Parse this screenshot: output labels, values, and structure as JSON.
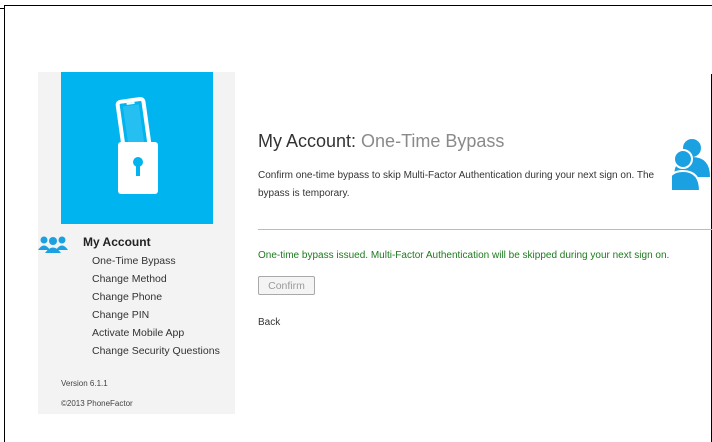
{
  "sidebar": {
    "account_title": "My Account",
    "items": [
      {
        "label": "One-Time Bypass"
      },
      {
        "label": "Change Method"
      },
      {
        "label": "Change Phone"
      },
      {
        "label": "Change PIN"
      },
      {
        "label": "Activate Mobile App"
      },
      {
        "label": "Change Security Questions"
      }
    ],
    "version": "Version 6.1.1",
    "copyright": "©2013 PhoneFactor",
    "logo_icon": "phone-lock-icon",
    "account_icon": "users-icon"
  },
  "main": {
    "title_prefix": "My Account: ",
    "title_section": "One-Time Bypass",
    "description": "Confirm one-time bypass to skip Multi-Factor Authentication during your next sign on. The bypass is temporary.",
    "success_message": "One-time bypass issued. Multi-Factor Authentication will be skipped during your next sign on.",
    "confirm_label": "Confirm",
    "back_label": "Back",
    "header_icon": "users-icon"
  },
  "colors": {
    "accent": "#00b4ef",
    "success": "#1e7a1e",
    "sidebar_bg": "#f3f3f3"
  }
}
